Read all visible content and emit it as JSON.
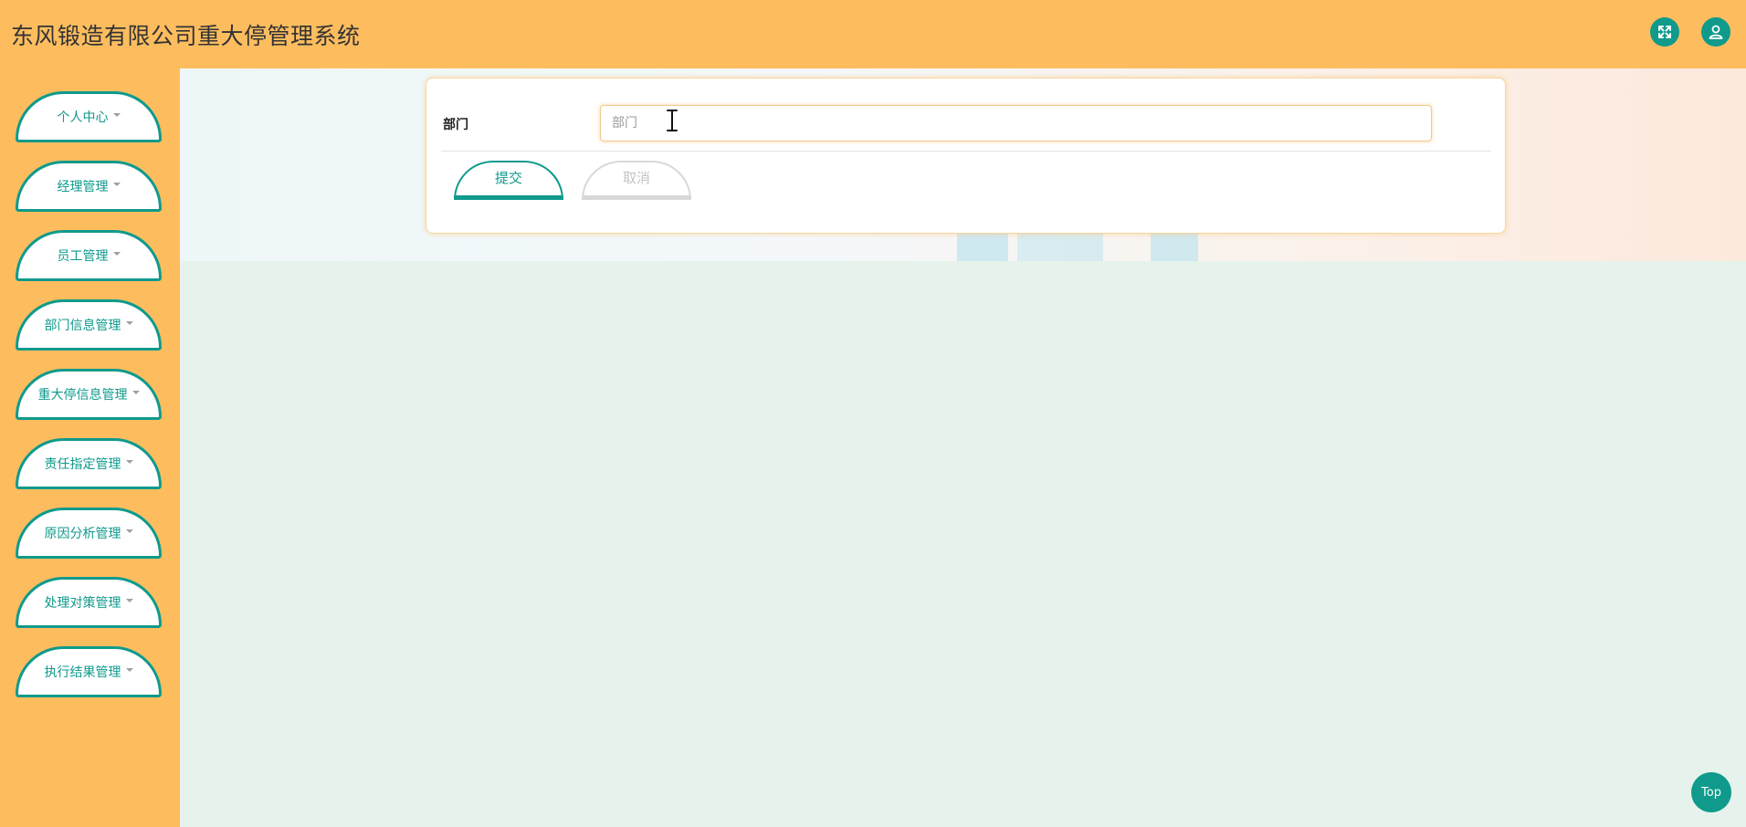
{
  "header": {
    "title": "东风锻造有限公司重大停管理系统",
    "expand_icon": "expand-icon",
    "user_icon": "user-icon"
  },
  "sidebar": {
    "items": [
      {
        "label": "个人中心"
      },
      {
        "label": "经理管理"
      },
      {
        "label": "员工管理"
      },
      {
        "label": "部门信息管理"
      },
      {
        "label": "重大停信息管理"
      },
      {
        "label": "责任指定管理"
      },
      {
        "label": "原因分析管理"
      },
      {
        "label": "处理对策管理"
      },
      {
        "label": "执行结果管理"
      }
    ]
  },
  "form": {
    "department_label": "部门",
    "department_value": "",
    "department_placeholder": "部门",
    "submit_label": "提交",
    "cancel_label": "取消"
  },
  "top_button": {
    "label": "Top"
  },
  "colors": {
    "header_bg": "#fdbd5f",
    "accent": "#0f9a8c",
    "main_bg": "#e6f3ec"
  }
}
